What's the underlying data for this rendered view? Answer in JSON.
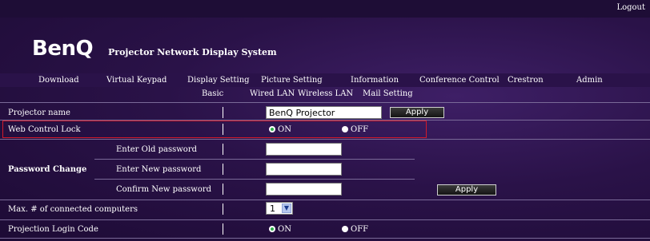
{
  "header": {
    "logout": "Logout",
    "logo": "BenQ",
    "system_title": "Projector Network Display System"
  },
  "nav": {
    "items": [
      "Download",
      "Virtual Keypad",
      "Display Setting",
      "Picture Setting",
      "Information",
      "Conference Control",
      "Crestron",
      "Admin"
    ]
  },
  "subnav": {
    "items": [
      "Basic",
      "Wired LAN",
      "Wireless LAN",
      "Mail Setting"
    ]
  },
  "form": {
    "projector_name": {
      "label": "Projector name",
      "value": "BenQ Projector",
      "apply": "Apply"
    },
    "web_control_lock": {
      "label": "Web Control Lock",
      "on": "ON",
      "off": "OFF",
      "selected": "ON"
    },
    "password_change": {
      "label": "Password Change",
      "old_label": "Enter Old password",
      "new_label": "Enter New password",
      "confirm_label": "Confirm New password",
      "apply": "Apply"
    },
    "max_connected": {
      "label": "Max. # of connected computers",
      "value": "1"
    },
    "projection_login_code": {
      "label": "Projection Login Code",
      "on": "ON",
      "off": "OFF",
      "selected": "ON"
    }
  },
  "colors": {
    "background": "#2a1248",
    "highlight_border": "#d11a2a",
    "radio_selected": "#2db24a"
  },
  "icons": {
    "dropdown": "chevron-down-icon",
    "radio": "radio-icon"
  }
}
